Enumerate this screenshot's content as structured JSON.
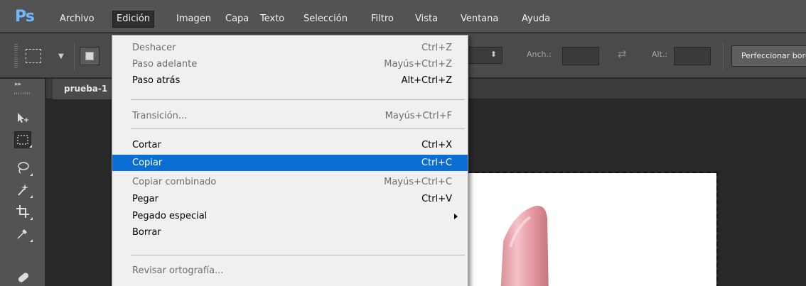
{
  "app": {
    "logo": "Ps",
    "accent_color": "#6fb9ff"
  },
  "menubar": {
    "items": [
      "Archivo",
      "Edición",
      "Imagen",
      "Capa",
      "Texto",
      "Selección",
      "Filtro",
      "Vista",
      "Ventana",
      "Ayuda"
    ],
    "active": "Edición"
  },
  "options": {
    "width_label": "Anch.:",
    "height_label": "Alt.:",
    "refine_button": "Perfeccionar borde",
    "icons": [
      "rect-marquee-icon",
      "chevron-down-icon",
      "new-selection-icon",
      "up-down-arrows-icon",
      "swap-arrows-icon"
    ]
  },
  "tools": {
    "header_icon": "double-chevron-right-icon",
    "items": [
      "move-tool-icon",
      "rect-marquee-tool-icon",
      "lasso-tool-icon",
      "magic-wand-tool-icon",
      "crop-tool-icon",
      "eyedropper-tool-icon",
      "healing-brush-tool-icon"
    ],
    "selected": "rect-marquee-tool-icon"
  },
  "document": {
    "tab_title": "prueba-1"
  },
  "edit_menu": {
    "highlight_color": "#0a6ed4",
    "entries": [
      {
        "label": "Deshacer",
        "shortcut": "Ctrl+Z",
        "disabled": true
      },
      {
        "label": "Paso adelante",
        "shortcut": "Mayús+Ctrl+Z",
        "disabled": true
      },
      {
        "label": "Paso atrás",
        "shortcut": "Alt+Ctrl+Z",
        "disabled": false
      },
      {
        "label": "Transición...",
        "shortcut": "Mayús+Ctrl+F",
        "disabled": true
      },
      {
        "label": "Cortar",
        "shortcut": "Ctrl+X",
        "disabled": false
      },
      {
        "label": "Copiar",
        "shortcut": "Ctrl+C",
        "disabled": false,
        "highlighted": true
      },
      {
        "label": "Copiar combinado",
        "shortcut": "Mayús+Ctrl+C",
        "disabled": true
      },
      {
        "label": "Pegar",
        "shortcut": "Ctrl+V",
        "disabled": false
      },
      {
        "label": "Pegado especial",
        "shortcut": "",
        "disabled": false,
        "submenu": true
      },
      {
        "label": "Borrar",
        "shortcut": "",
        "disabled": false
      },
      {
        "label": "Revisar ortografía...",
        "shortcut": "",
        "disabled": true
      }
    ]
  }
}
